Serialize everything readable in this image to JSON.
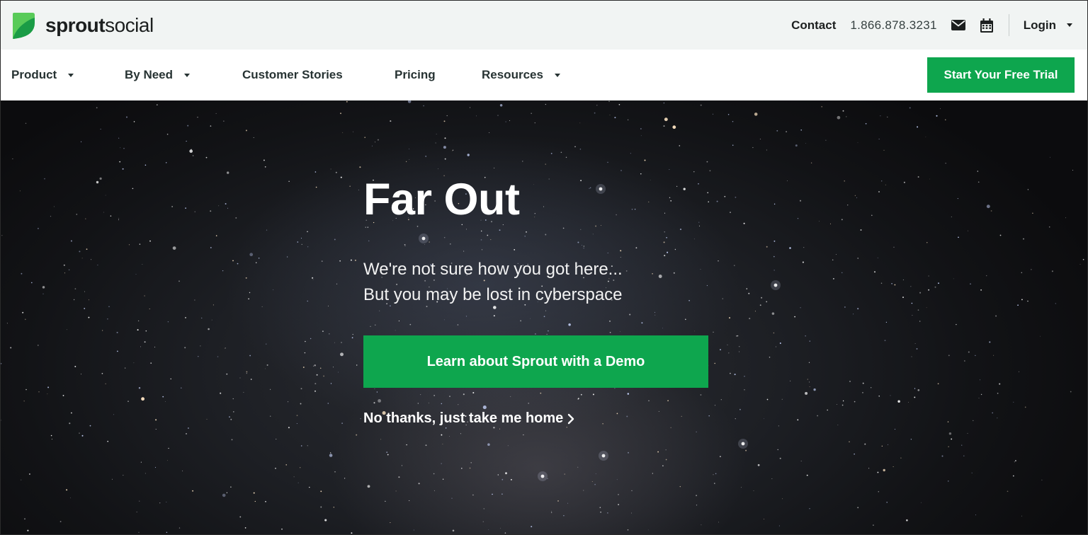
{
  "brand": {
    "name_bold": "sprout",
    "name_regular": "social",
    "green": "#0ea64e",
    "logo_icon": "leaf-icon"
  },
  "topbar": {
    "contact_label": "Contact",
    "phone": "1.866.878.3231",
    "mail_icon": "mail-icon",
    "calendar_icon": "calendar-icon",
    "login_label": "Login"
  },
  "nav": {
    "items": [
      {
        "label": "Product",
        "dropdown": true
      },
      {
        "label": "By Need",
        "dropdown": true
      },
      {
        "label": "Customer Stories",
        "dropdown": false
      },
      {
        "label": "Pricing",
        "dropdown": false
      },
      {
        "label": "Resources",
        "dropdown": true
      }
    ],
    "cta_label": "Start Your Free Trial"
  },
  "hero": {
    "title": "Far Out",
    "subtitle_line1": "We're not sure how you got here...",
    "subtitle_line2": "But you may be lost in cyberspace",
    "cta_label": "Learn about Sprout with a Demo",
    "home_link_label": "No thanks, just take me home"
  }
}
